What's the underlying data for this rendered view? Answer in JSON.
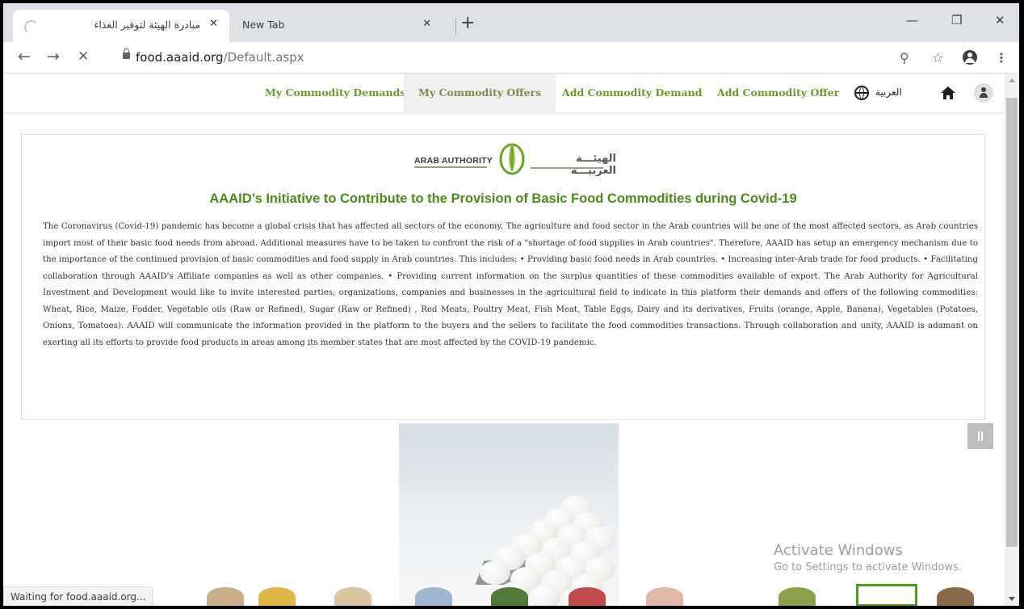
{
  "browser": {
    "tabs": [
      {
        "title": "مبادرة الهيئة لتوفير الغذاء",
        "close": "✕",
        "active": true,
        "loading": true
      },
      {
        "title": "New Tab",
        "close": "✕",
        "active": false
      }
    ],
    "new_tab": "+",
    "window_controls": {
      "minimize": "—",
      "restore": "❐",
      "close": "✕"
    },
    "nav": {
      "back": "←",
      "forward": "→",
      "stop": "✕"
    },
    "url": {
      "host": "food.aaaid.org",
      "path": "/Default.aspx"
    },
    "icons": {
      "zoom": "⚲",
      "bookmark": "☆",
      "menu": "⋮"
    }
  },
  "site_nav": {
    "links": [
      {
        "label": "My Commodity Demands",
        "active": false
      },
      {
        "label": "My Commodity Offers",
        "active": true
      },
      {
        "label": "Add Commodity Demand",
        "active": false
      },
      {
        "label": "Add Commodity Offer",
        "active": false
      }
    ],
    "language": "العربية"
  },
  "logo": {
    "english": "ARAB AUTHORITY",
    "arabic": "الهيئـــة العربيـــة"
  },
  "heading": "AAAID’s Initiative to Contribute to the Provision of Basic Food Commodities during Covid-19",
  "body": "The Coronavirus (Covid-19) pandemic has become a global crisis that has affected all sectors of the economy. The agriculture and food sector in the Arab countries will be one of the most affected sectors, as Arab countries import most of their basic food needs from abroad. Additional measures have to be taken to confront the risk of a \"shortage of food supplies in Arab countries\". Therefore, AAAID has setup an emergency mechanism due to the importance of the continued provision of basic commodities and food supply in Arab countries. This includes: • Providing basic food needs in Arab countries. • Increasing inter-Arab trade for food products. • Facilitating collaboration through AAAID's Affiliate companies as well as other companies. • Providing current information on the surplus quantities of these commodities available of export. The Arab Authority for Agricultural Investment and Development would like to invite interested parties, organizations, companies and businesses in the agricultural field to indicate in this platform their demands and offers of the following commodities: Wheat, Rice, Maize, Fodder, Vegetable oils (Raw or Refined), Sugar (Raw or Refined) , Red Meats, Poultry Meat, Fish Meat, Table Eggs, Dairy and its derivatives, Fruits (orange, Apple, Banana), Vegetables (Potatoes, Onions, Tomatoes). AAAID will communicate the information provided in the platform to the buyers and the sellers to facilitate the food commodities transactions. Through collaboration and unity, AAAID is adamant on exerting all its efforts to provide food products in areas among its member states that are most affected by the COVID-19 pandemic.",
  "watermark": {
    "title": "Activate Windows",
    "subtitle": "Go to Settings to activate Windows."
  },
  "status_bar": "Waiting for food.aaaid.org...",
  "colors": {
    "nav_link": "#6a9a2a",
    "heading": "#4e8a1a",
    "tabstrip": "#dee1e6"
  }
}
